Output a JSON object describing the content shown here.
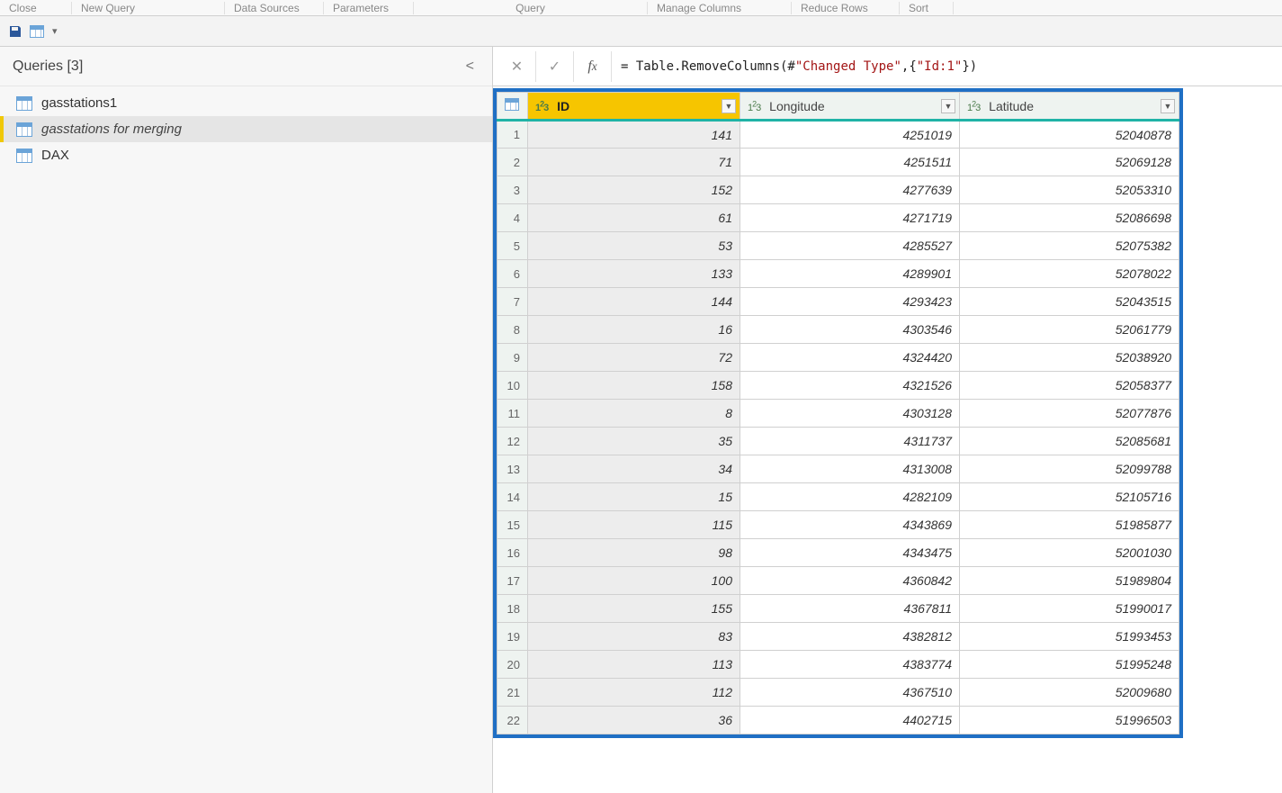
{
  "ribbon": {
    "groups": [
      "Close",
      "New Query",
      "Data Sources",
      "Parameters",
      "Query",
      "Manage Columns",
      "Reduce Rows",
      "Sort"
    ]
  },
  "sidebar": {
    "title": "Queries [3]",
    "items": [
      {
        "label": "gasstations1",
        "selected": false
      },
      {
        "label": "gasstations for merging",
        "selected": true
      },
      {
        "label": "DAX",
        "selected": false
      }
    ]
  },
  "formula": {
    "prefix": "= Table.RemoveColumns(#",
    "q1": "\"Changed Type\"",
    "mid": ",{",
    "q2": "\"Id:1\"",
    "suffix": "})"
  },
  "columns": [
    {
      "name": "ID",
      "type": "123",
      "selected": true
    },
    {
      "name": "Longitude",
      "type": "123",
      "selected": false
    },
    {
      "name": "Latitude",
      "type": "123",
      "selected": false
    }
  ],
  "rows": [
    {
      "id": 141,
      "lon": 4251019,
      "lat": 52040878
    },
    {
      "id": 71,
      "lon": 4251511,
      "lat": 52069128
    },
    {
      "id": 152,
      "lon": 4277639,
      "lat": 52053310
    },
    {
      "id": 61,
      "lon": 4271719,
      "lat": 52086698
    },
    {
      "id": 53,
      "lon": 4285527,
      "lat": 52075382
    },
    {
      "id": 133,
      "lon": 4289901,
      "lat": 52078022
    },
    {
      "id": 144,
      "lon": 4293423,
      "lat": 52043515
    },
    {
      "id": 16,
      "lon": 4303546,
      "lat": 52061779
    },
    {
      "id": 72,
      "lon": 4324420,
      "lat": 52038920
    },
    {
      "id": 158,
      "lon": 4321526,
      "lat": 52058377
    },
    {
      "id": 8,
      "lon": 4303128,
      "lat": 52077876
    },
    {
      "id": 35,
      "lon": 4311737,
      "lat": 52085681
    },
    {
      "id": 34,
      "lon": 4313008,
      "lat": 52099788
    },
    {
      "id": 15,
      "lon": 4282109,
      "lat": 52105716
    },
    {
      "id": 115,
      "lon": 4343869,
      "lat": 51985877
    },
    {
      "id": 98,
      "lon": 4343475,
      "lat": 52001030
    },
    {
      "id": 100,
      "lon": 4360842,
      "lat": 51989804
    },
    {
      "id": 155,
      "lon": 4367811,
      "lat": 51990017
    },
    {
      "id": 83,
      "lon": 4382812,
      "lat": 51993453
    },
    {
      "id": 113,
      "lon": 4383774,
      "lat": 51995248
    },
    {
      "id": 112,
      "lon": 4367510,
      "lat": 52009680
    },
    {
      "id": 36,
      "lon": 4402715,
      "lat": 51996503
    }
  ]
}
